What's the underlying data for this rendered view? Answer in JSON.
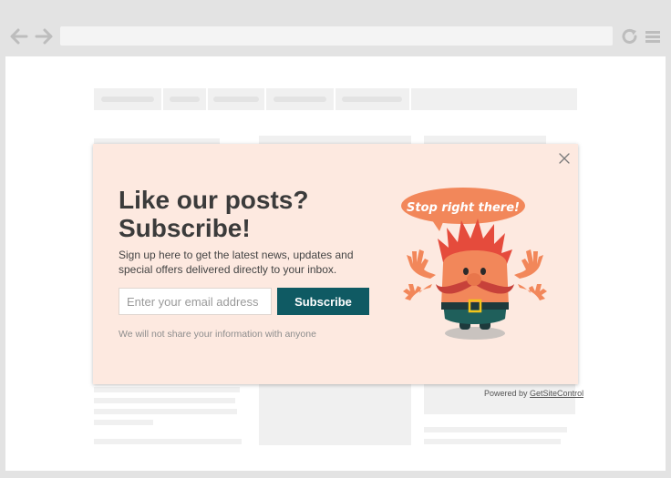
{
  "browser": {
    "back_icon": "arrow-left-icon",
    "forward_icon": "arrow-right-icon",
    "reload_icon": "reload-icon",
    "menu_icon": "hamburger-menu-icon"
  },
  "popup": {
    "title": "Like our posts? Subscribe!",
    "description": "Sign up here to get the latest news, updates and special offers delivered directly to your inbox.",
    "email_placeholder": "Enter your email address",
    "email_value": "",
    "subscribe_label": "Subscribe",
    "privacy_note": "We will not share your information with anyone",
    "speech_bubble": "Stop right there!",
    "close_icon": "close-icon",
    "colors": {
      "background": "#fde9e0",
      "button": "#0f5a63",
      "bubble": "#f2875a",
      "mascot_hair": "#e54b3c",
      "mascot_body": "#f2875a",
      "mustache": "#c7413a"
    }
  },
  "footer": {
    "powered_prefix": "Powered by",
    "powered_link": "GetSiteControl"
  }
}
